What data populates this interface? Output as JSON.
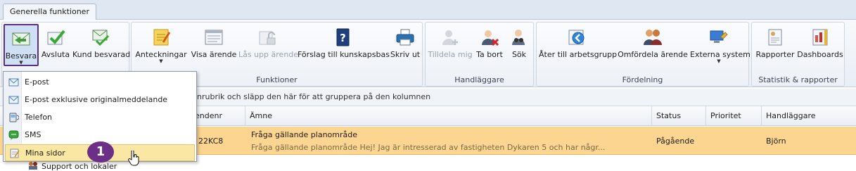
{
  "tabs": {
    "active": "Generella funktioner"
  },
  "ribbon": {
    "groups": {
      "funktioner": "Funktioner",
      "handlaggare": "Handläggare",
      "fordelning": "Fördelning",
      "statistik": "Statistik & rapporter"
    },
    "buttons": {
      "besvara": "Besvara",
      "avsluta": "Avsluta",
      "kund_besvarad": "Kund besvarad",
      "anteckningar": "Anteckningar",
      "visa_arende": "Visa ärende",
      "las_upp_arende": "Lås upp ärende",
      "forslag": "Förslag till kunskapsbas",
      "skriv_ut": "Skriv ut",
      "tilldela_mig": "Tilldela mig",
      "ta_bort": "Ta bort",
      "sok": "Sök",
      "ater_till_arbetsgrupp": "Åter till arbetsgrupp",
      "omfordela_arende": "Omfördela ärende",
      "externa_system": "Externa system",
      "rapporter": "Rapporter",
      "dashboards": "Dashboards"
    }
  },
  "grouping_hint": "nrubrik och släpp den här för att gruppera på den kolumnen",
  "table": {
    "columns": {
      "arendenr": "endenr",
      "amne": "Ämne",
      "status": "Status",
      "prioritet": "Prioritet",
      "handlaggare": "Handläggare"
    },
    "rows": [
      {
        "arendenr": "22KC8",
        "amne_title": "Fråga gällande planområde",
        "amne_preview": "Fråga gällande planområde Hej! Jag är intresserad av fastigheten Dykaren 5 och har någr...",
        "status": "Pågående",
        "prioritet": "",
        "handlaggare": "Björn"
      }
    ],
    "partial_row": "Support och lokaler"
  },
  "dropdown": {
    "items": [
      {
        "label": "E-post",
        "icon": "envelope-icon"
      },
      {
        "label": "E-post exklusive originalmeddelande",
        "icon": "envelope-icon"
      },
      {
        "label": "Telefon",
        "icon": "phone-icon"
      },
      {
        "label": "SMS",
        "icon": "sms-icon"
      },
      {
        "label": "Mina sidor",
        "icon": "note-icon"
      }
    ]
  },
  "callout": {
    "number": "1"
  },
  "colors": {
    "highlight_row": "#fcd590",
    "callout": "#6b2f87",
    "menu_hover": "#fbe7a4"
  }
}
